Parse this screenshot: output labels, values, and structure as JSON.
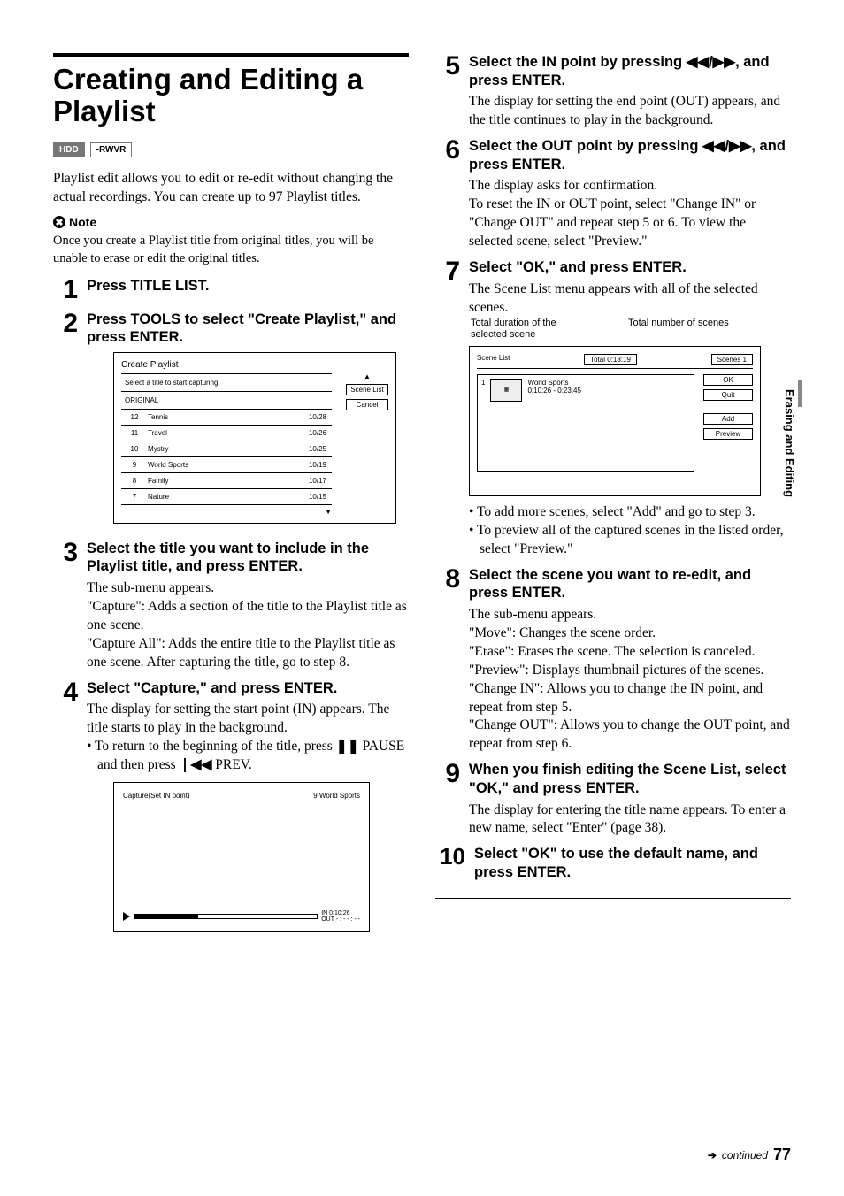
{
  "sidetab": "Erasing and Editing",
  "title": "Creating and Editing a Playlist",
  "badges": {
    "hdd": "HDD",
    "rwvr": "-RWVR"
  },
  "intro": "Playlist edit allows you to edit or re-edit without changing the actual recordings. You can create up to 97 Playlist titles.",
  "noteHead": "Note",
  "noteBody": "Once you create a Playlist title from original titles, you will be unable to erase or edit the original titles.",
  "step1": {
    "head": "Press TITLE LIST."
  },
  "step2": {
    "head": "Press TOOLS to select \"Create Playlist,\" and press ENTER."
  },
  "ui1": {
    "title": "Create Playlist",
    "prompt": "Select a title to start capturing.",
    "section": "ORIGINAL",
    "rows": [
      {
        "n": "12",
        "t": "Tennis",
        "d": "10/28"
      },
      {
        "n": "11",
        "t": "Travel",
        "d": "10/26"
      },
      {
        "n": "10",
        "t": "Mystry",
        "d": "10/25"
      },
      {
        "n": "9",
        "t": "World Sports",
        "d": "10/19"
      },
      {
        "n": "8",
        "t": "Family",
        "d": "10/17"
      },
      {
        "n": "7",
        "t": "Nature",
        "d": "10/15"
      }
    ],
    "btnSceneList": "Scene List",
    "btnCancel": "Cancel"
  },
  "step3": {
    "head": "Select the title you want to include in the Playlist title, and press ENTER.",
    "d1": "The sub-menu appears.",
    "d2": "\"Capture\": Adds a section of the title to the Playlist title as one scene.",
    "d3": "\"Capture All\": Adds the entire title to the Playlist title as one scene. After capturing the title, go to step 8."
  },
  "step4": {
    "head": "Select \"Capture,\" and press ENTER.",
    "d1": "The display for setting the start point (IN) appears. The title starts to play in the background.",
    "b1": "To return to the beginning of the title, press ",
    "b1b": " PAUSE and then press ",
    "b1c": " PREV."
  },
  "ui2": {
    "title": "Capture(Set IN point)",
    "right": "9 World Sports",
    "in": "IN  0:10:26",
    "out": "OUT - : - - : - -"
  },
  "step5": {
    "head1": "Select the IN point by pressing ",
    "head2": ", and press ENTER.",
    "d1": "The display for setting the end point (OUT) appears, and the title continues to play in the background."
  },
  "step6": {
    "head1": "Select the OUT point by pressing ",
    "head2": ", and press ENTER.",
    "d1": "The display asks for confirmation.",
    "d2": "To reset the IN or OUT point, select \"Change IN\" or \"Change OUT\" and repeat step 5 or 6. To view the selected scene, select \"Preview.\""
  },
  "step7": {
    "head": "Select \"OK,\" and press ENTER.",
    "d1": "The Scene List menu appears with all of the selected scenes.",
    "ann1": "Total duration of the selected scene",
    "ann2": "Total number of scenes"
  },
  "ui3": {
    "left": "Scene List",
    "mid": "Total 0:13:19",
    "right": "Scenes 1",
    "itemNum": "1",
    "itemTitle": "World Sports",
    "itemTime": "0:10:26 - 0:23:45",
    "ok": "OK",
    "quit": "Quit",
    "add": "Add",
    "preview": "Preview"
  },
  "step7b1": "To add more scenes, select \"Add\" and go to step 3.",
  "step7b2": "To preview all of the captured scenes in the listed order, select \"Preview.\"",
  "step8": {
    "head": "Select the scene you want to re-edit, and press ENTER.",
    "d1": "The sub-menu appears.",
    "d2": "\"Move\": Changes the scene order.",
    "d3": "\"Erase\": Erases the scene. The selection is canceled.",
    "d4": "\"Preview\": Displays thumbnail pictures of the scenes.",
    "d5": "\"Change IN\": Allows you to change the IN point, and repeat from step 5.",
    "d6": "\"Change OUT\": Allows you to change the OUT point, and repeat from step 6."
  },
  "step9": {
    "head": "When you finish editing the Scene List, select \"OK,\" and press ENTER.",
    "d1": "The display for entering the title name appears. To enter a new name, select \"Enter\" (page 38)."
  },
  "step10": {
    "head": "Select \"OK\" to use the default name, and press ENTER."
  },
  "footer": {
    "cont": "continued",
    "page": "77"
  }
}
